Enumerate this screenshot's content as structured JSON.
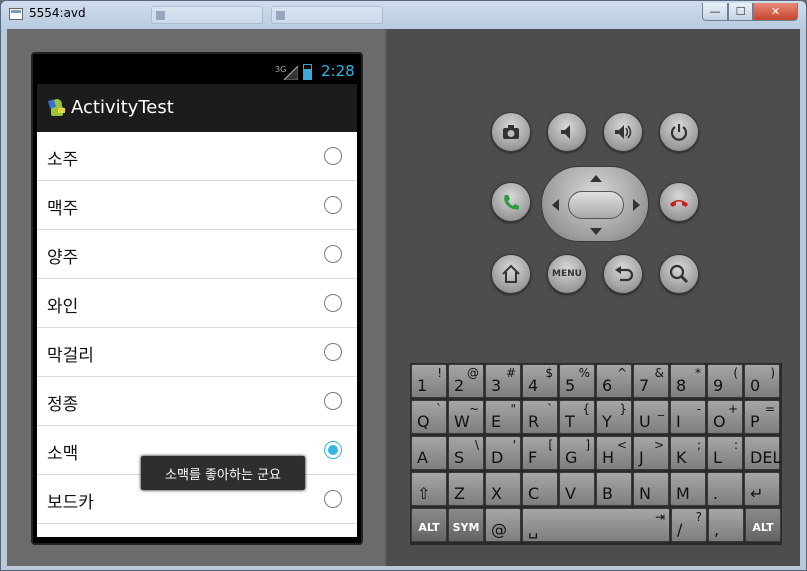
{
  "window": {
    "title": "5554:avd",
    "min_label": "—",
    "max_label": "☐",
    "close_label": "✕"
  },
  "status_bar": {
    "network": "3G",
    "time": "2:28"
  },
  "app": {
    "title": "ActivityTest"
  },
  "list": {
    "items": [
      {
        "label": "소주",
        "checked": false
      },
      {
        "label": "맥주",
        "checked": false
      },
      {
        "label": "양주",
        "checked": false
      },
      {
        "label": "와인",
        "checked": false
      },
      {
        "label": "막걸리",
        "checked": false
      },
      {
        "label": "정종",
        "checked": false
      },
      {
        "label": "소맥",
        "checked": true
      },
      {
        "label": "보드카",
        "checked": false
      }
    ]
  },
  "toast": {
    "text": "소맥를 좋아하는 군요"
  },
  "hardware_buttons": {
    "menu_label": "MENU"
  },
  "keyboard": {
    "row1": [
      {
        "main": "1",
        "alt": "!"
      },
      {
        "main": "2",
        "alt": "@"
      },
      {
        "main": "3",
        "alt": "#"
      },
      {
        "main": "4",
        "alt": "$"
      },
      {
        "main": "5",
        "alt": "%"
      },
      {
        "main": "6",
        "alt": "^"
      },
      {
        "main": "7",
        "alt": "&"
      },
      {
        "main": "8",
        "alt": "*"
      },
      {
        "main": "9",
        "alt": "("
      },
      {
        "main": "0",
        "alt": ")"
      }
    ],
    "row2": [
      {
        "main": "Q",
        "alt": "`"
      },
      {
        "main": "W",
        "alt": "~"
      },
      {
        "main": "E",
        "alt": "\""
      },
      {
        "main": "R",
        "alt": "`"
      },
      {
        "main": "T",
        "alt": "{"
      },
      {
        "main": "Y",
        "alt": "}"
      },
      {
        "main": "U",
        "alt": "_"
      },
      {
        "main": "I",
        "alt": "-"
      },
      {
        "main": "O",
        "alt": "+"
      },
      {
        "main": "P",
        "alt": "="
      }
    ],
    "row3": [
      {
        "main": "A",
        "alt": ""
      },
      {
        "main": "S",
        "alt": "\\"
      },
      {
        "main": "D",
        "alt": "'"
      },
      {
        "main": "F",
        "alt": "["
      },
      {
        "main": "G",
        "alt": "]"
      },
      {
        "main": "H",
        "alt": "<"
      },
      {
        "main": "J",
        "alt": ">"
      },
      {
        "main": "K",
        "alt": ";"
      },
      {
        "main": "L",
        "alt": ":"
      },
      {
        "main": "DEL",
        "alt": ""
      }
    ],
    "row4": [
      {
        "main": "⇧",
        "alt": ""
      },
      {
        "main": "Z",
        "alt": ""
      },
      {
        "main": "X",
        "alt": ""
      },
      {
        "main": "C",
        "alt": ""
      },
      {
        "main": "V",
        "alt": ""
      },
      {
        "main": "B",
        "alt": ""
      },
      {
        "main": "N",
        "alt": ""
      },
      {
        "main": "M",
        "alt": ""
      },
      {
        "main": ".",
        "alt": ""
      },
      {
        "main": "↵",
        "alt": ""
      }
    ],
    "row5": [
      {
        "main": "ALT",
        "alt": ""
      },
      {
        "main": "SYM",
        "alt": ""
      },
      {
        "main": "@",
        "alt": ""
      },
      {
        "main": "␣",
        "alt": "⇥"
      },
      {
        "main": "/",
        "alt": "?"
      },
      {
        "main": ",",
        "alt": ""
      },
      {
        "main": "ALT",
        "alt": ""
      }
    ]
  },
  "colors": {
    "accent": "#33b5e5",
    "call_green": "#2a9a3a",
    "end_red": "#c4221c"
  }
}
